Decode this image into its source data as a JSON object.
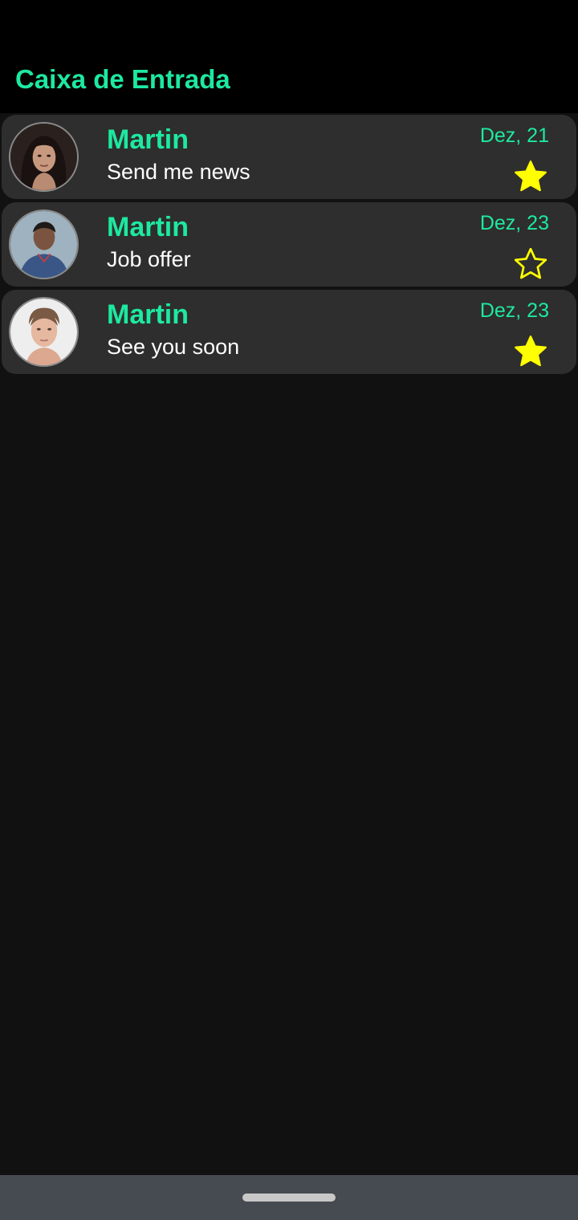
{
  "header": {
    "title": "Caixa de Entrada"
  },
  "colors": {
    "accent": "#1de9a0",
    "star": "#ffff00",
    "row_background": "#2e2e2e",
    "app_background": "#111111"
  },
  "messages": [
    {
      "sender": "Martin",
      "subject": "Send me news",
      "date": "Dez, 21",
      "starred": true,
      "avatar": "avatar-woman-dark-hair"
    },
    {
      "sender": "Martin",
      "subject": "Job offer",
      "date": "Dez, 23",
      "starred": false,
      "avatar": "avatar-man-blue-shirt"
    },
    {
      "sender": "Martin",
      "subject": "See you soon",
      "date": "Dez, 23",
      "starred": true,
      "avatar": "avatar-young-man"
    }
  ]
}
